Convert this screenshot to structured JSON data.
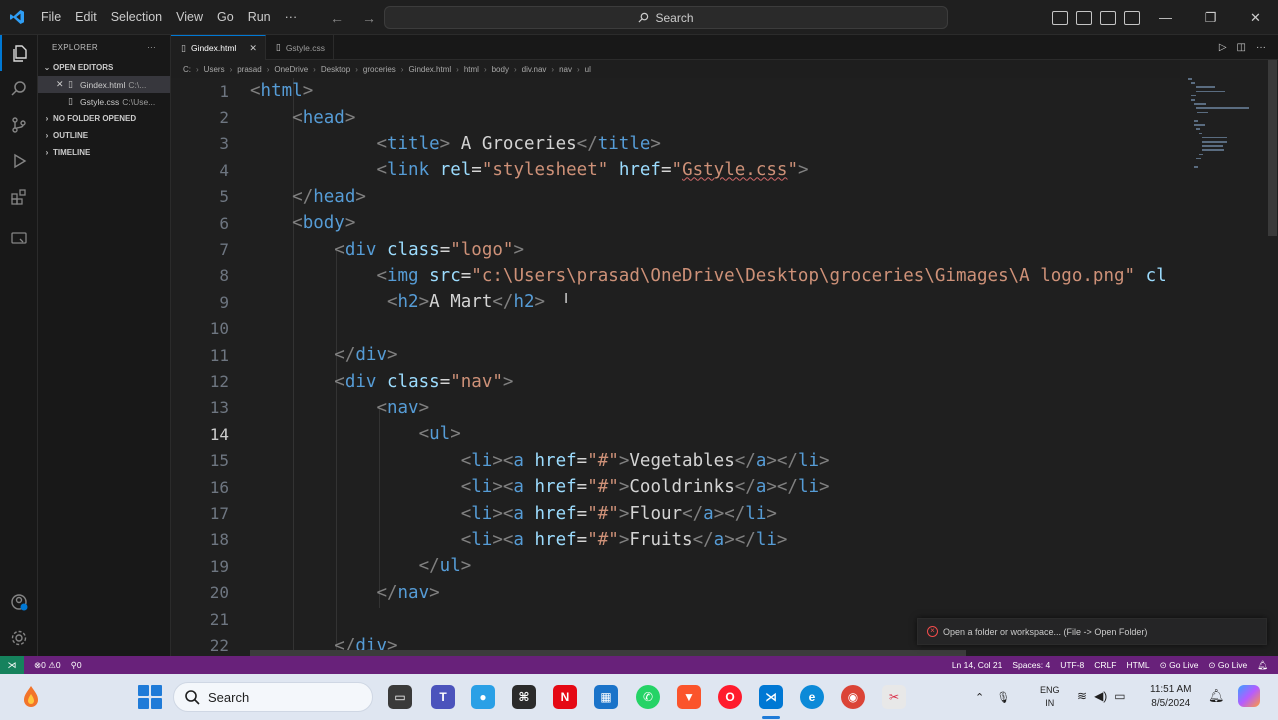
{
  "menu": [
    "File",
    "Edit",
    "Selection",
    "View",
    "Go",
    "Run",
    "···"
  ],
  "search": {
    "label": "Search"
  },
  "sidebar": {
    "title": "EXPLORER",
    "sections": {
      "open_editors": "OPEN EDITORS",
      "no_folder": "NO FOLDER OPENED",
      "outline": "OUTLINE",
      "timeline": "TIMELINE"
    },
    "open_files": [
      {
        "name": "Gindex.html",
        "path": "C:\\...",
        "active": true
      },
      {
        "name": "Gstyle.css",
        "path": "C:\\Use...",
        "active": false
      }
    ]
  },
  "tabs": [
    {
      "label": "Gindex.html",
      "active": true
    },
    {
      "label": "Gstyle.css",
      "active": false
    }
  ],
  "breadcrumb": [
    "C:",
    "Users",
    "prasad",
    "OneDrive",
    "Desktop",
    "groceries",
    "Gindex.html",
    "html",
    "body",
    "div.nav",
    "nav",
    "ul"
  ],
  "code_lines": [
    {
      "n": "1",
      "html": "<span class='t'>&lt;</span><span class='tn'>html</span><span class='t'>&gt;</span>"
    },
    {
      "n": "2",
      "html": "    <span class='t'>&lt;</span><span class='tn'>head</span><span class='t'>&gt;</span>"
    },
    {
      "n": "3",
      "html": "            <span class='t'>&lt;</span><span class='tn'>title</span><span class='t'>&gt;</span><span class='tx'> A Groceries</span><span class='t'>&lt;/</span><span class='tn'>title</span><span class='t'>&gt;</span>"
    },
    {
      "n": "4",
      "html": "            <span class='t'>&lt;</span><span class='tn'>link</span> <span class='an'>rel</span><span class='tx'>=</span><span class='av'>\"stylesheet\"</span> <span class='an'>href</span><span class='tx'>=</span><span class='av'>\"<span class='ul'>Gstyle.css</span>\"</span><span class='t'>&gt;</span>"
    },
    {
      "n": "5",
      "html": "    <span class='t'>&lt;/</span><span class='tn'>head</span><span class='t'>&gt;</span>"
    },
    {
      "n": "6",
      "html": "    <span class='t'>&lt;</span><span class='tn'>body</span><span class='t'>&gt;</span>"
    },
    {
      "n": "7",
      "html": "        <span class='t'>&lt;</span><span class='tn'>div</span> <span class='an'>class</span><span class='tx'>=</span><span class='av'>\"logo\"</span><span class='t'>&gt;</span>"
    },
    {
      "n": "8",
      "html": "            <span class='t'>&lt;</span><span class='tn'>img</span> <span class='an'>src</span><span class='tx'>=</span><span class='av'>\"c:\\Users\\prasad\\OneDrive\\Desktop\\groceries\\Gimages\\A logo.png\"</span> <span class='an'>cl</span>"
    },
    {
      "n": "9",
      "html": "             <span class='t'>&lt;</span><span class='tn'>h2</span><span class='t'>&gt;</span><span class='tx'>A Mart</span><span class='t'>&lt;/</span><span class='tn'>h2</span><span class='t'>&gt;</span>"
    },
    {
      "n": "10",
      "html": ""
    },
    {
      "n": "11",
      "html": "        <span class='t'>&lt;/</span><span class='tn'>div</span><span class='t'>&gt;</span>"
    },
    {
      "n": "12",
      "html": "        <span class='t'>&lt;</span><span class='tn'>div</span> <span class='an'>class</span><span class='tx'>=</span><span class='av'>\"nav\"</span><span class='t'>&gt;</span>"
    },
    {
      "n": "13",
      "html": "            <span class='t'>&lt;</span><span class='tn'>nav</span><span class='t'>&gt;</span>"
    },
    {
      "n": "14",
      "html": "                <span class='t'>&lt;</span><span class='tn'>ul</span><span class='t'>&gt;</span>"
    },
    {
      "n": "15",
      "html": "                    <span class='t'>&lt;</span><span class='tn'>li</span><span class='t'>&gt;&lt;</span><span class='tn'>a</span> <span class='an'>href</span><span class='tx'>=</span><span class='av'>\"#\"</span><span class='t'>&gt;</span><span class='tx'>Vegetables</span><span class='t'>&lt;/</span><span class='tn'>a</span><span class='t'>&gt;&lt;/</span><span class='tn'>li</span><span class='t'>&gt;</span>"
    },
    {
      "n": "16",
      "html": "                    <span class='t'>&lt;</span><span class='tn'>li</span><span class='t'>&gt;&lt;</span><span class='tn'>a</span> <span class='an'>href</span><span class='tx'>=</span><span class='av'>\"#\"</span><span class='t'>&gt;</span><span class='tx'>Cooldrinks</span><span class='t'>&lt;/</span><span class='tn'>a</span><span class='t'>&gt;&lt;/</span><span class='tn'>li</span><span class='t'>&gt;</span>"
    },
    {
      "n": "17",
      "html": "                    <span class='t'>&lt;</span><span class='tn'>li</span><span class='t'>&gt;&lt;</span><span class='tn'>a</span> <span class='an'>href</span><span class='tx'>=</span><span class='av'>\"#\"</span><span class='t'>&gt;</span><span class='tx'>Flour</span><span class='t'>&lt;/</span><span class='tn'>a</span><span class='t'>&gt;&lt;/</span><span class='tn'>li</span><span class='t'>&gt;</span>"
    },
    {
      "n": "18",
      "html": "                    <span class='t'>&lt;</span><span class='tn'>li</span><span class='t'>&gt;&lt;</span><span class='tn'>a</span> <span class='an'>href</span><span class='tx'>=</span><span class='av'>\"#\"</span><span class='t'>&gt;</span><span class='tx'>Fruits</span><span class='t'>&lt;/</span><span class='tn'>a</span><span class='t'>&gt;&lt;/</span><span class='tn'>li</span><span class='t'>&gt;</span>"
    },
    {
      "n": "19",
      "html": "                <span class='t'>&lt;/</span><span class='tn'>ul</span><span class='t'>&gt;</span>"
    },
    {
      "n": "20",
      "html": "            <span class='t'>&lt;/</span><span class='tn'>nav</span><span class='t'>&gt;</span>"
    },
    {
      "n": "21",
      "html": ""
    },
    {
      "n": "22",
      "html": "        <span class='t'>&lt;/</span><span class='tn'>div</span><span class='t'>&gt;</span>"
    }
  ],
  "current_line": "14",
  "notification": {
    "text": "Open a folder or workspace... (File -> Open Folder)"
  },
  "statusbar": {
    "errors": "0",
    "warnings": "0",
    "ports": "0",
    "position": "Ln 14, Col 21",
    "spaces": "Spaces: 4",
    "encoding": "UTF-8",
    "eol": "CRLF",
    "language": "HTML",
    "golive1": "Go Live",
    "golive2": "Go Live"
  },
  "taskbar": {
    "search": "Search",
    "lang_top": "ENG",
    "lang_bottom": "IN",
    "time": "11:51 AM",
    "date": "8/5/2024"
  },
  "colors": {
    "accent": "#0078d4",
    "statusbar": "#68217a",
    "remote": "#16825d"
  }
}
